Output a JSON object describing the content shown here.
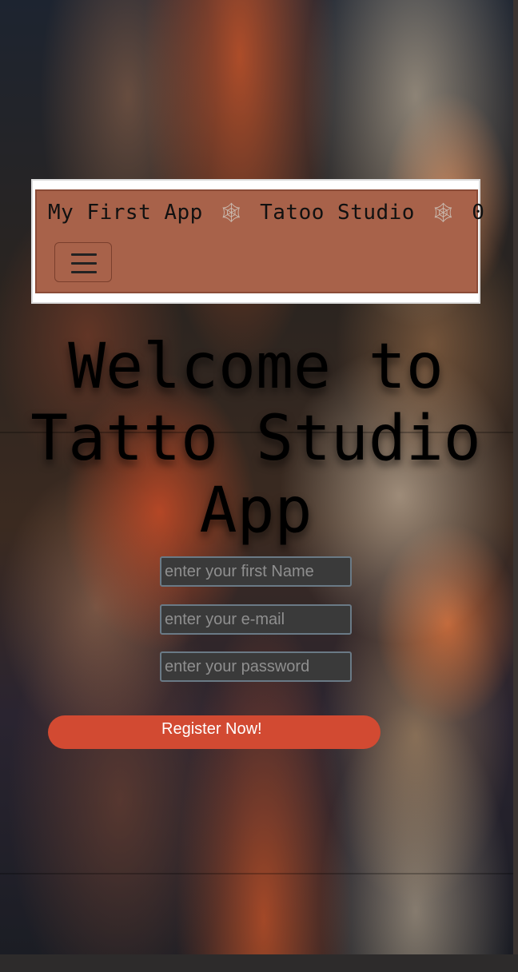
{
  "navbar": {
    "brand_parts": [
      "My First App",
      "Tatoo Studio",
      "0"
    ],
    "separator_icon": "spider-web-icon",
    "toggler_icon": "hamburger-menu-icon",
    "background_color": "#a8624a"
  },
  "hero": {
    "title": "Welcome to Tatto Studio App"
  },
  "form": {
    "first_name_placeholder": "enter your first Name",
    "email_placeholder": "enter your e-mail",
    "password_placeholder": "enter your password",
    "register_label": "Register Now!",
    "button_color": "#d24a32"
  }
}
